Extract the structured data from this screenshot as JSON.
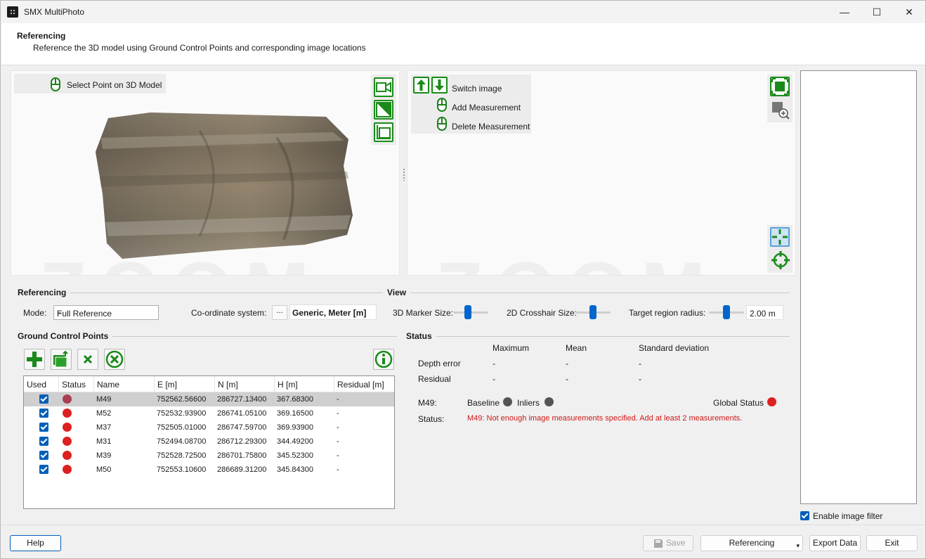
{
  "window": {
    "title": "SMX MultiPhoto",
    "minimize": "—",
    "maximize": "☐",
    "close": "✕"
  },
  "header": {
    "title": "Referencing",
    "subtitle": "Reference the 3D model using Ground Control Points and corresponding image locations"
  },
  "viewer3d": {
    "select_point_label": "Select Point on 3D Model",
    "watermark": "ZOOM"
  },
  "image_viewer": {
    "switch_image": "Switch image",
    "add_measurement": "Add Measurement",
    "delete_measurement": "Delete Measurement",
    "watermark": "ZOOM"
  },
  "referencing": {
    "title": "Referencing",
    "mode_label": "Mode:",
    "mode_value": "Full Reference",
    "coord_label": "Co-ordinate system:",
    "coord_btn": "...",
    "coord_value": "Generic, Meter [m]"
  },
  "view": {
    "title": "View",
    "marker_label": "3D Marker Size:",
    "marker_level": 0.4,
    "crosshair_label": "2D Crosshair Size:",
    "crosshair_level": 0.5,
    "radius_label": "Target region radius:",
    "radius_level": 0.5,
    "radius_value": "2.00 m"
  },
  "gcp": {
    "title": "Ground Control Points",
    "columns": [
      "Used",
      "Status",
      "Name",
      "E [m]",
      "N [m]",
      "H [m]",
      "Residual [m]"
    ],
    "rows": [
      {
        "name": "M49",
        "e": "752562.56600",
        "n": "286727.13400",
        "h": "367.68300",
        "res": "-"
      },
      {
        "name": "M52",
        "e": "752532.93900",
        "n": "286741.05100",
        "h": "369.16500",
        "res": "-"
      },
      {
        "name": "M37",
        "e": "752505.01000",
        "n": "286747.59700",
        "h": "369.93900",
        "res": "-"
      },
      {
        "name": "M31",
        "e": "752494.08700",
        "n": "286712.29300",
        "h": "344.49200",
        "res": "-"
      },
      {
        "name": "M39",
        "e": "752528.72500",
        "n": "286701.75800",
        "h": "345.52300",
        "res": "-"
      },
      {
        "name": "M50",
        "e": "752553.10600",
        "n": "286689.31200",
        "h": "345.84300",
        "res": "-"
      }
    ]
  },
  "status": {
    "title": "Status",
    "col_max": "Maximum",
    "col_mean": "Mean",
    "col_std": "Standard deviation",
    "depth_label": "Depth error",
    "depth_max": "-",
    "depth_mean": "-",
    "depth_std": "-",
    "residual_label": "Residual",
    "res_max": "-",
    "res_mean": "-",
    "res_std": "-",
    "point_label": "M49:",
    "baseline_label": "Baseline",
    "inliers_label": "Inliers",
    "global_label": "Global Status",
    "status_label": "Status:",
    "message": "M49: Not enough image measurements specified. Add at least 2 measurements."
  },
  "filter": {
    "label": "Enable image filter"
  },
  "footer": {
    "help": "Help",
    "save": "Save",
    "referencing": "Referencing",
    "export": "Export Data",
    "exit": "Exit"
  },
  "colors": {
    "accent": "#005fb8",
    "status_red": "#dd2020",
    "icon_green": "#1a8a1a"
  }
}
